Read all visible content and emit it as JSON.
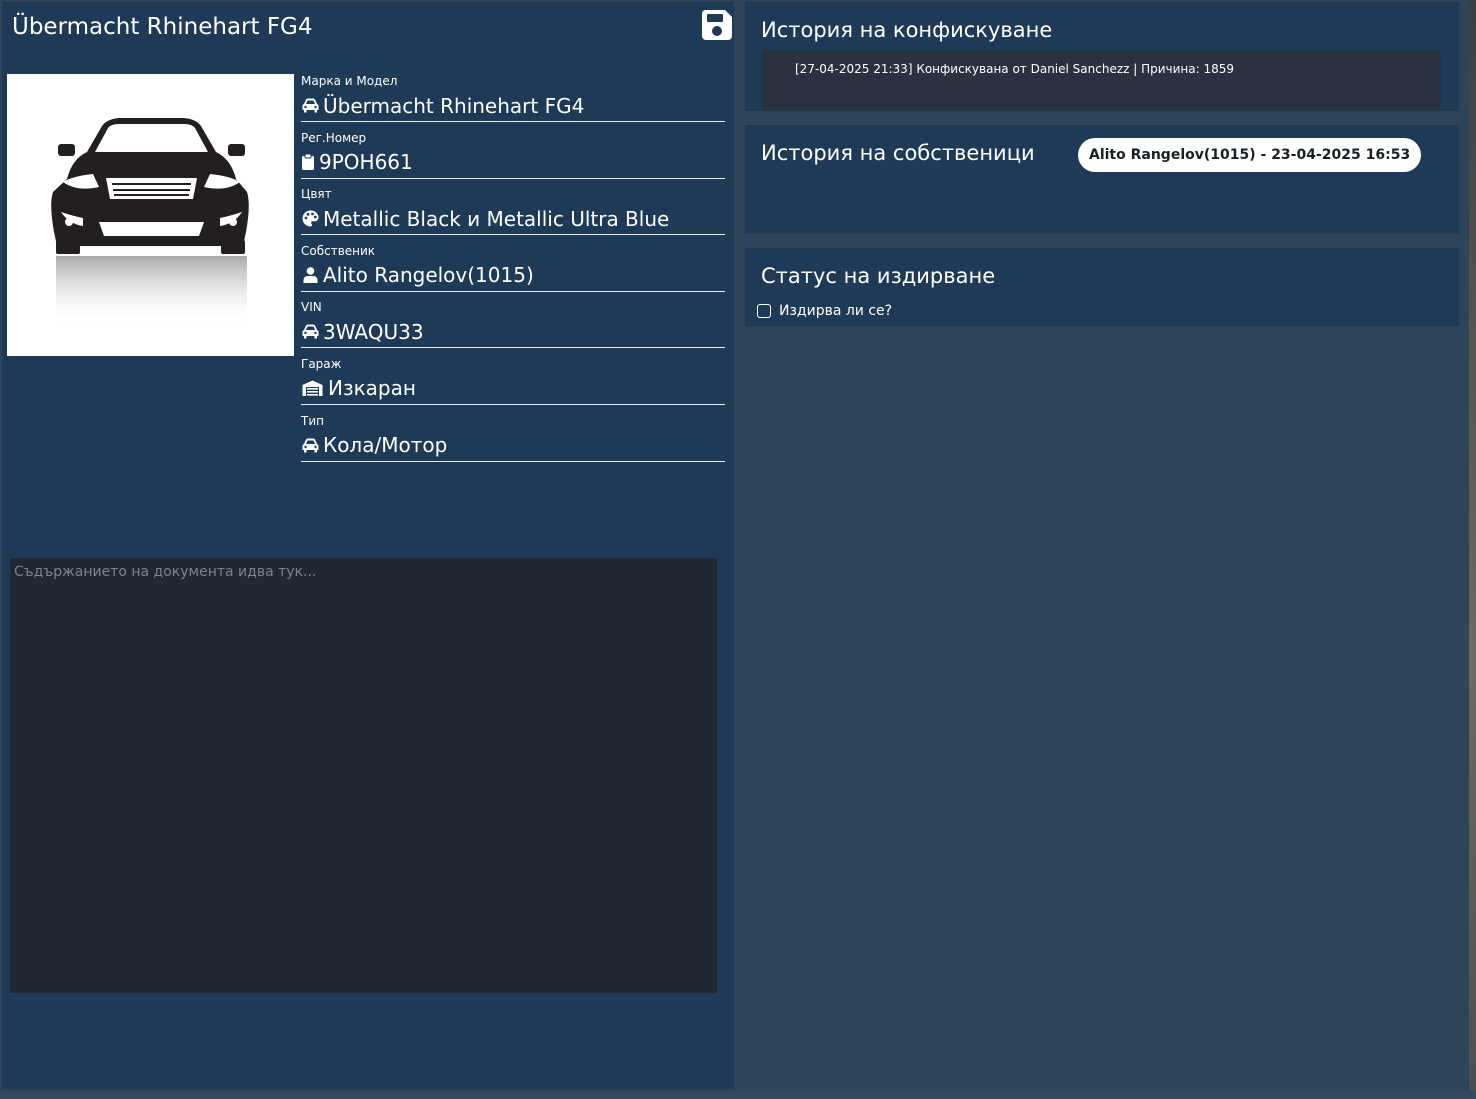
{
  "vehicle": {
    "title": "Übermacht Rhinehart FG4"
  },
  "toolbar": {
    "save_icon": "floppy-disk-icon"
  },
  "fields": [
    {
      "label": "Марка и Модел",
      "value": "Übermacht Rhinehart FG4",
      "icon": "car-icon"
    },
    {
      "label": "Рег.Номер",
      "value": "9POH661",
      "icon": "clipboard-icon"
    },
    {
      "label": "Цвят",
      "value": "Metallic Black и Metallic Ultra Blue",
      "icon": "palette-icon"
    },
    {
      "label": "Собственик",
      "value": "Alito Rangelov(1015)",
      "icon": "user-icon"
    },
    {
      "label": "VIN",
      "value": "3WAQU33",
      "icon": "car-icon"
    },
    {
      "label": "Гараж",
      "value": "Изкаран",
      "icon": "warehouse-icon"
    },
    {
      "label": "Тип",
      "value": "Кола/Мотор",
      "icon": "car-icon"
    }
  ],
  "notes": {
    "placeholder": "Съдържанието на документа идва тук...",
    "value": ""
  },
  "confiscation": {
    "title": "История на конфискуване",
    "entries": [
      "[27-04-2025 21:33] Конфискувана от Daniel Sanchezz | Причина: 1859"
    ]
  },
  "owners": {
    "title": "История на собственици",
    "entries": [
      "Alito Rangelov(1015) - 23-04-2025 16:53"
    ]
  },
  "wanted": {
    "title": "Статус на издирване",
    "checkbox_label": "Издирва ли се?",
    "checked": false
  },
  "colors": {
    "panel": "#1f3a56",
    "background": "#2f4459",
    "notes_bg": "#212833",
    "log_bg": "#2a3240",
    "text": "#ffffff"
  }
}
